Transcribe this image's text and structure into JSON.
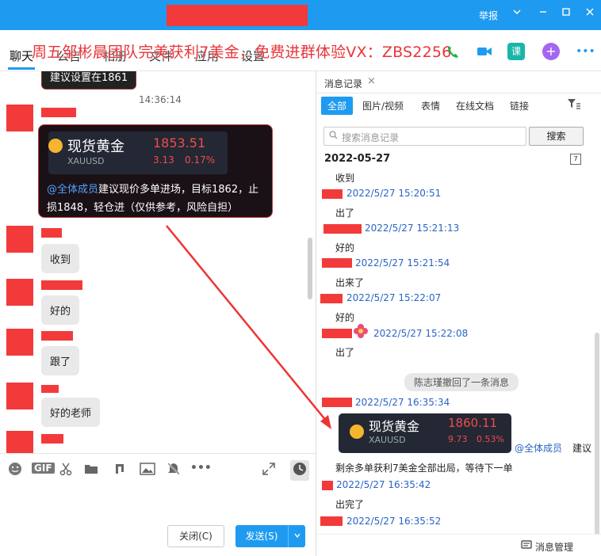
{
  "titlebar": {
    "report": "举报",
    "chevron": "chevron-down-icon",
    "minimize": "minimize-icon",
    "maximize": "maximize-icon",
    "close": "close-icon"
  },
  "nav": {
    "tabs": [
      "聊天",
      "公告",
      "相册",
      "文件",
      "应用",
      "设置"
    ],
    "banner": "周五邹彬晨团队完美获利7美金，免费进群体验VX：ZBS2256",
    "icons": {
      "phone": "phone-icon",
      "video": "video-icon",
      "course": "课",
      "add": "+",
      "more": "•••"
    }
  },
  "chat": {
    "top_bubble": "建议设置在1861",
    "time": "14:36:14",
    "card": {
      "name": "现货黄金",
      "symbol": "XAUUSD",
      "price": "1853.51",
      "change": "3.13",
      "percent": "0.17%",
      "mention": "@全体成员",
      "text": "建议现价多单进场，目标1862，止损1848，轻仓进（仅供参考，风险自担）"
    },
    "messages": [
      "收到",
      "好的",
      "跟了",
      "好的老师"
    ]
  },
  "toolbar": {
    "icons": [
      "emoji-icon",
      "gif-icon",
      "scissors-icon",
      "folder-icon",
      "music-icon",
      "image-icon",
      "mute-icon",
      "more-icon",
      "expand-icon",
      "clock-icon"
    ],
    "gif_label": "GIF",
    "more_label": "•••"
  },
  "buttons": {
    "close": "关闭(C)",
    "send": "发送(S)"
  },
  "history": {
    "tab": "消息记录",
    "filters": [
      "全部",
      "图片/视频",
      "表情",
      "在线文档",
      "链接"
    ],
    "search_placeholder": "搜索消息记录",
    "search_button": "搜索",
    "date": "2022-05-27",
    "calendar_label": "7",
    "first_msg": "收到",
    "entries": [
      {
        "time": "2022/5/27 15:20:51",
        "msg": "出了"
      },
      {
        "time": "2022/5/27 15:21:13",
        "msg": "好的"
      },
      {
        "time": "2022/5/27 15:21:54",
        "msg": "出来了"
      },
      {
        "time": "2022/5/27 15:22:07",
        "msg": "好的"
      },
      {
        "time": "2022/5/27 15:22:08",
        "msg": "出了"
      }
    ],
    "recall": "陈志瑾撤回了一条消息",
    "entry_card_time": "2022/5/27 16:35:34",
    "card": {
      "name": "现货黄金",
      "symbol": "XAUUSD",
      "price": "1860.11",
      "change": "9.73",
      "percent": "0.53%"
    },
    "card_mention": "@全体成员",
    "card_suggest": "建议",
    "card_follow": "剩余多单获利7美金全部出局，等待下一单",
    "entry2_time": "2022/5/27 16:35:42",
    "entry2_msg": "出完了",
    "entry3_time": "2022/5/27 16:35:52",
    "footer": "消息管理",
    "colors": {
      "accent": "#1e9bf0",
      "redact": "#f33a3a",
      "time": "#2a64c6",
      "price": "#f14b4b"
    }
  }
}
